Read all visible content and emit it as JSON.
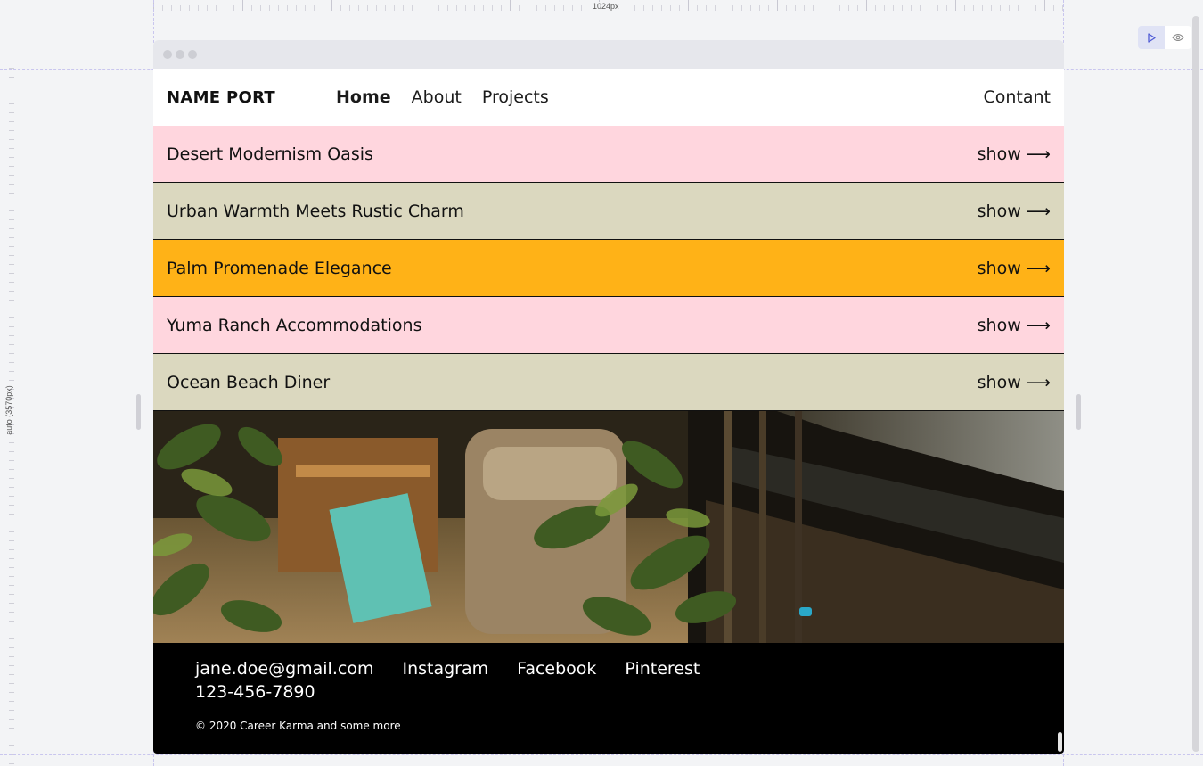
{
  "editor": {
    "ruler_width_label": "1024px",
    "ruler_height_label": "auto (3570px)",
    "play_icon": "play-icon",
    "preview_icon": "eye-icon"
  },
  "site": {
    "brand": "NAME PORT",
    "nav": [
      {
        "label": "Home",
        "active": true
      },
      {
        "label": "About",
        "active": false
      },
      {
        "label": "Projects",
        "active": false
      }
    ],
    "contact_label": "Contant"
  },
  "projects": [
    {
      "title": "Desert Modernism Oasis",
      "action": "show",
      "arrow": "⟶",
      "color": "#ffd6de"
    },
    {
      "title": "Urban Warmth Meets Rustic Charm",
      "action": "show",
      "arrow": "⟶",
      "color": "#dbd8bf"
    },
    {
      "title": "Palm Promenade Elegance",
      "action": "show",
      "arrow": "⟶",
      "color": "#ffb217"
    },
    {
      "title": "Yuma Ranch Accommodations",
      "action": "show",
      "arrow": "⟶",
      "color": "#ffd6de"
    },
    {
      "title": "Ocean Beach Diner",
      "action": "show",
      "arrow": "⟶",
      "color": "#dbd8bf"
    }
  ],
  "footer": {
    "email": "jane.doe@gmail.com",
    "socials": [
      "Instagram",
      "Facebook",
      "Pinterest"
    ],
    "phone": "123-456-7890",
    "copyright": "© 2020 Career Karma and some more"
  }
}
